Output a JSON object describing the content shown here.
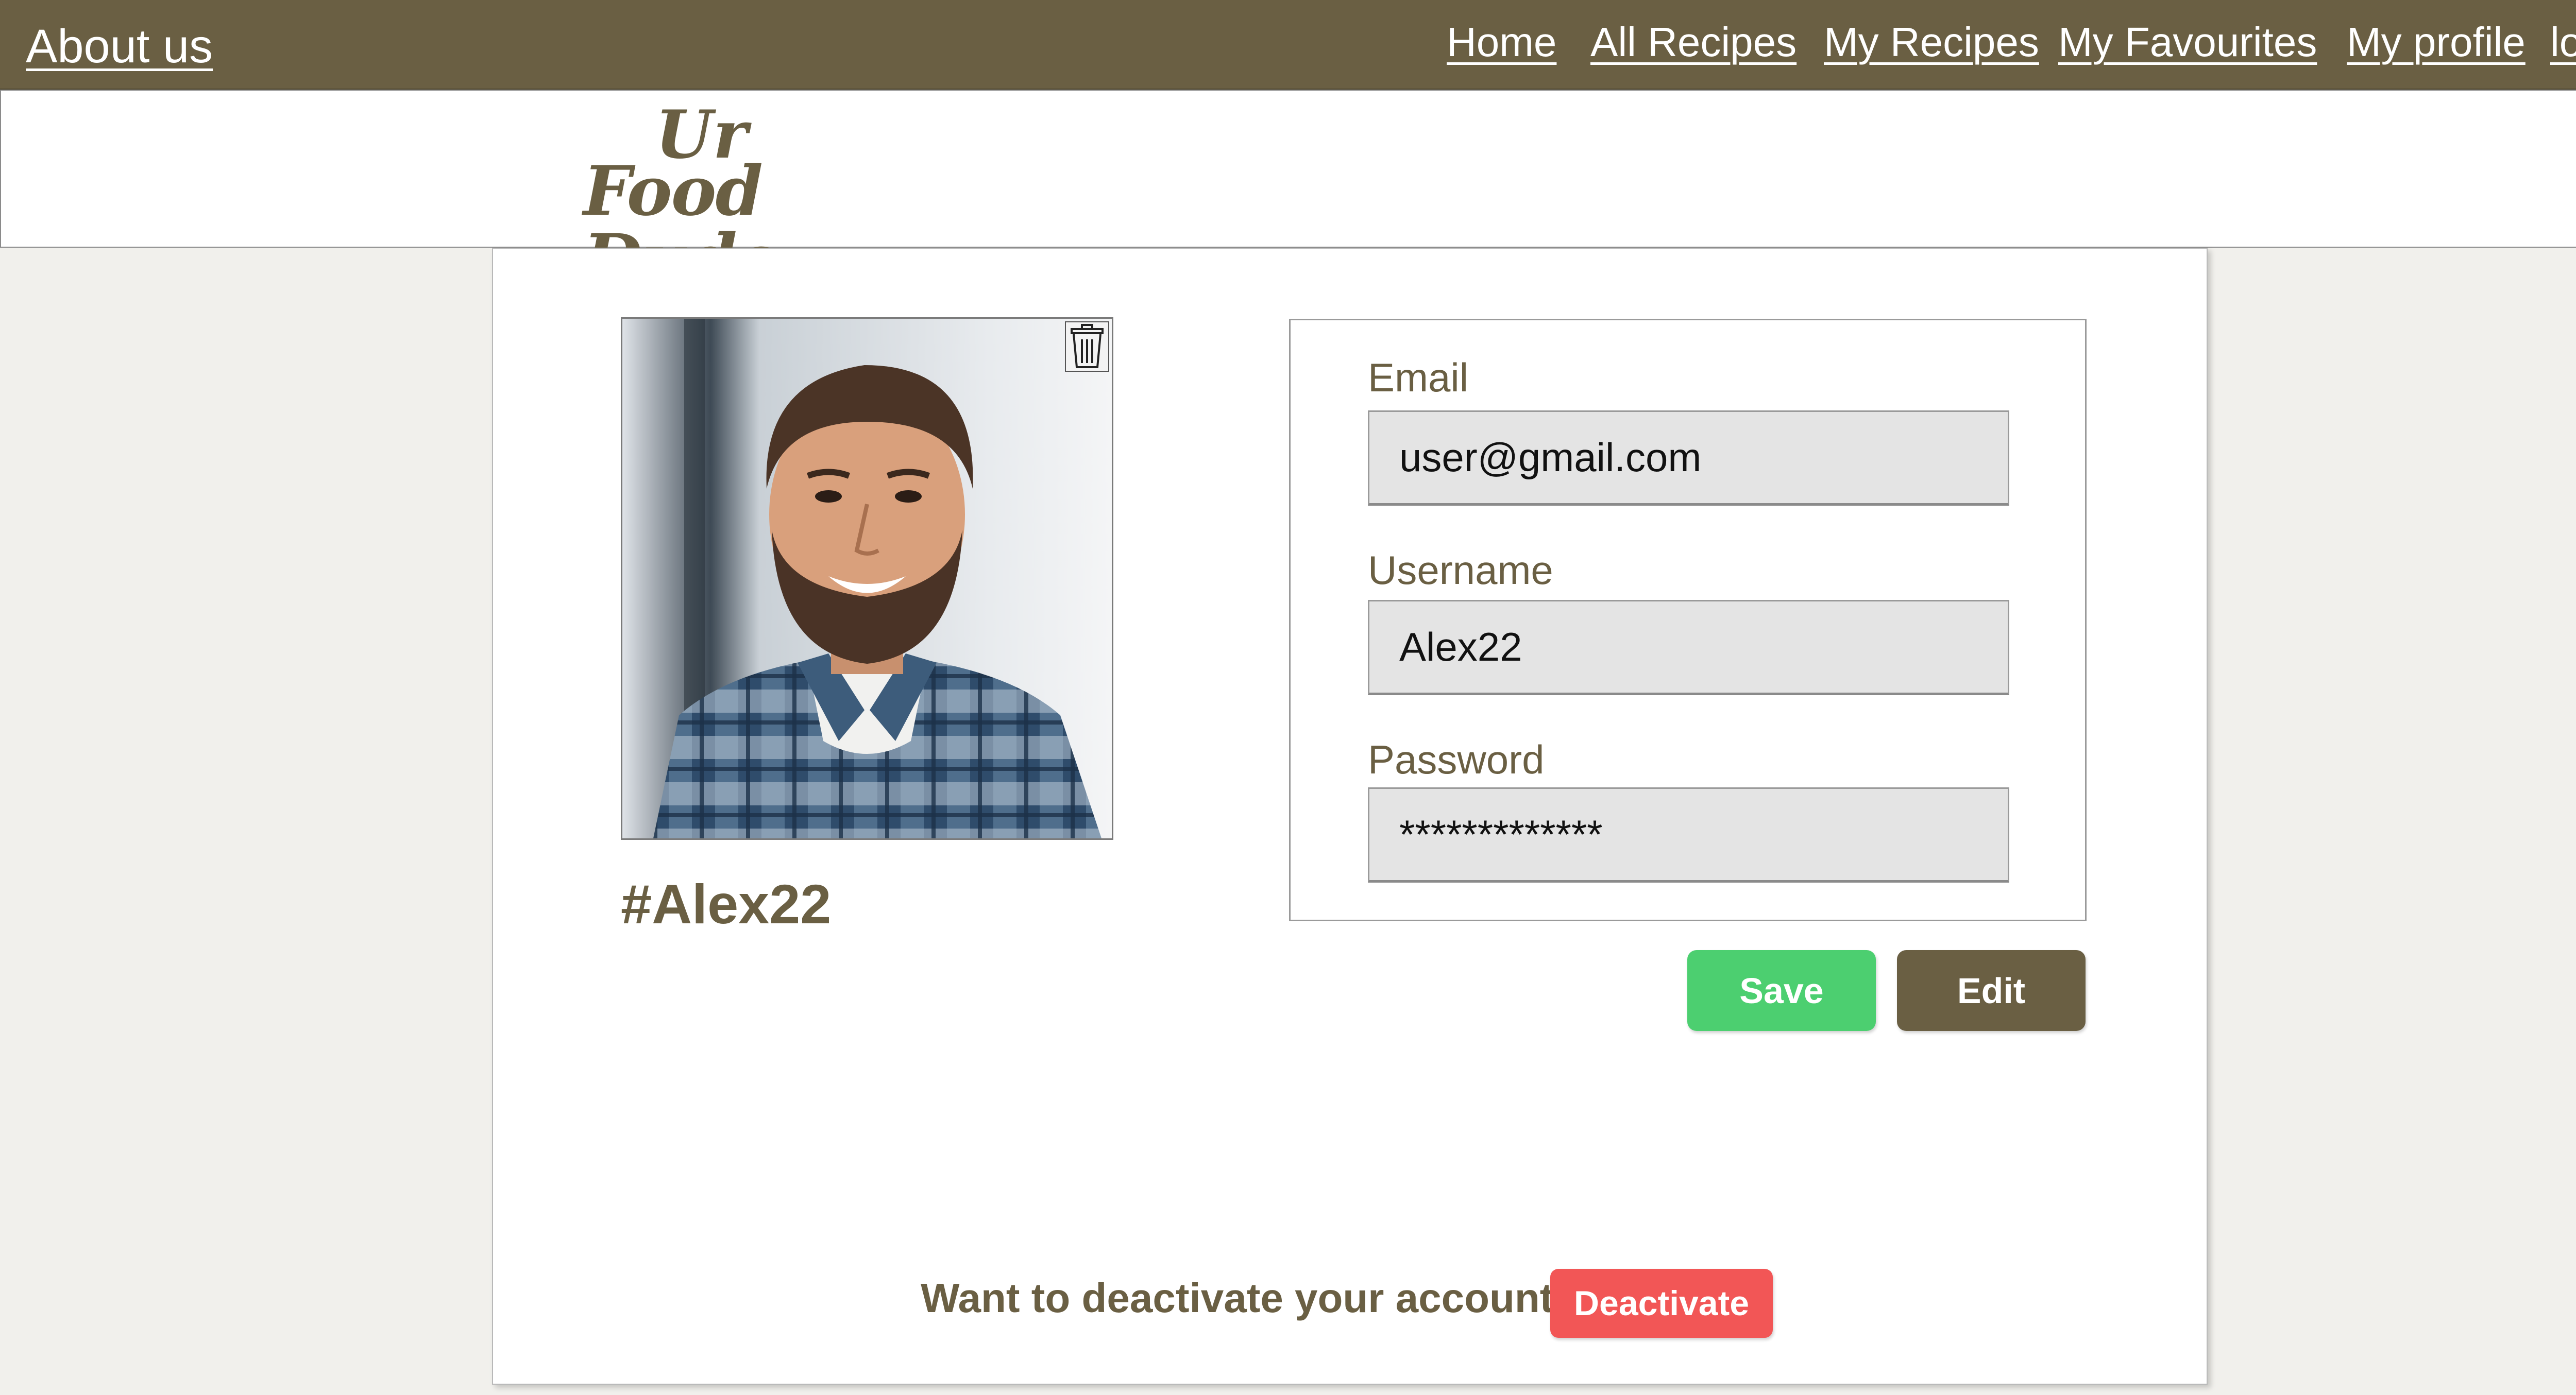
{
  "header": {
    "about_label": "About us",
    "nav": {
      "home": "Home",
      "all_recipes": "All Recipes",
      "my_recipes": "My Recipes",
      "my_favourites": "My Favourites",
      "my_profile": "My profile",
      "log_out": "log out"
    },
    "logo_line1": "Ur",
    "logo_line2": "Food Dude"
  },
  "profile": {
    "handle": "#Alex22",
    "avatar_alt": "profile photo",
    "delete_icon": "trash-icon"
  },
  "form": {
    "email_label": "Email",
    "email_value": "user@gmail.com",
    "username_label": "Username",
    "username_value": "Alex22",
    "password_label": "Password",
    "password_value": "*************"
  },
  "actions": {
    "save_label": "Save",
    "edit_label": "Edit"
  },
  "deactivate": {
    "prompt": "Want to deactivate your account?",
    "button_label": "Deactivate"
  },
  "colors": {
    "brand": "#6a5f43",
    "save": "#4ccf70",
    "deactivate": "#f25656",
    "input_bg": "#e4e4e4"
  }
}
